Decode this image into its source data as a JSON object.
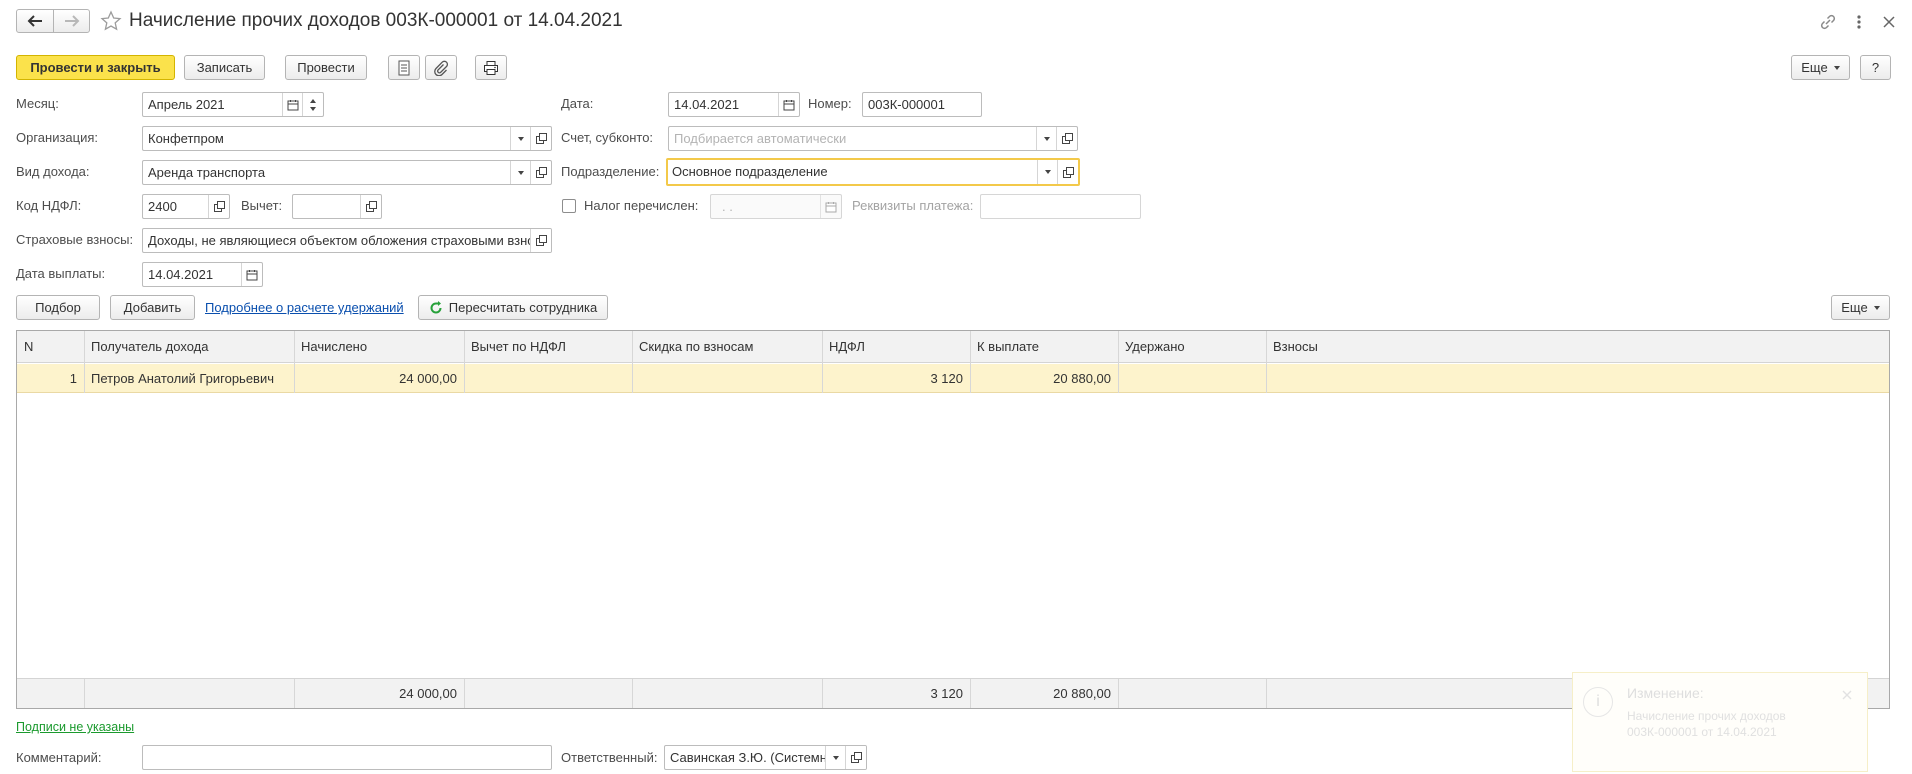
{
  "window": {
    "title": "Начисление прочих доходов 003К-000001 от 14.04.2021"
  },
  "toolbar": {
    "post_close": "Провести и закрыть",
    "save": "Записать",
    "post": "Провести",
    "more": "Еще",
    "help": "?"
  },
  "form": {
    "month": {
      "label": "Месяц:",
      "value": "Апрель 2021"
    },
    "date": {
      "label": "Дата:",
      "value": "14.04.2021"
    },
    "number": {
      "label": "Номер:",
      "value": "003К-000001"
    },
    "organization": {
      "label": "Организация:",
      "value": "Конфетпром"
    },
    "account": {
      "label": "Счет, субконто:",
      "placeholder": "Подбирается автоматически"
    },
    "income_type": {
      "label": "Вид дохода:",
      "value": "Аренда транспорта"
    },
    "department": {
      "label": "Подразделение:",
      "value": "Основное подразделение"
    },
    "ndfl_code": {
      "label": "Код НДФЛ:",
      "value": "2400"
    },
    "deduction": {
      "label": "Вычет:",
      "value": ""
    },
    "tax_transferred": {
      "label": "Налог перечислен:",
      "value": " .  ."
    },
    "payment_details": {
      "label": "Реквизиты платежа:",
      "value": ""
    },
    "insurance": {
      "label": "Страховые взносы:",
      "value": "Доходы, не являющиеся объектом обложения страховыми взносами"
    },
    "pay_date": {
      "label": "Дата выплаты:",
      "value": "14.04.2021"
    }
  },
  "table_toolbar": {
    "pick": "Подбор",
    "add": "Добавить",
    "details_link": "Подробнее о расчете удержаний",
    "recalc": "Пересчитать сотрудника",
    "more": "Еще"
  },
  "table": {
    "headers": [
      "N",
      "Получатель дохода",
      "Начислено",
      "Вычет по НДФЛ",
      "Скидка по взносам",
      "НДФЛ",
      "К выплате",
      "Удержано",
      "Взносы"
    ],
    "rows": [
      [
        "1",
        "Петров Анатолий Григорьевич",
        "24 000,00",
        "",
        "",
        "3 120",
        "20 880,00",
        "",
        ""
      ]
    ],
    "totals": [
      "",
      "",
      "24 000,00",
      "",
      "",
      "3 120",
      "20 880,00",
      "",
      ""
    ]
  },
  "footer": {
    "signatures_link": "Подписи не указаны",
    "comment": {
      "label": "Комментарий:",
      "value": ""
    },
    "responsible": {
      "label": "Ответственный:",
      "value": "Савинская З.Ю. (Системный администратор)"
    }
  },
  "notification": {
    "title": "Изменение:",
    "text_line1": "Начисление прочих доходов",
    "text_line2": "003К-000001 от 14.04.2021"
  },
  "colors": {
    "accent_yellow": "#fbe24b",
    "row_selected": "#fdf3cc",
    "link_blue": "#0a4fae",
    "link_green": "#1b9a2e",
    "focus_border": "#f3c94a"
  }
}
